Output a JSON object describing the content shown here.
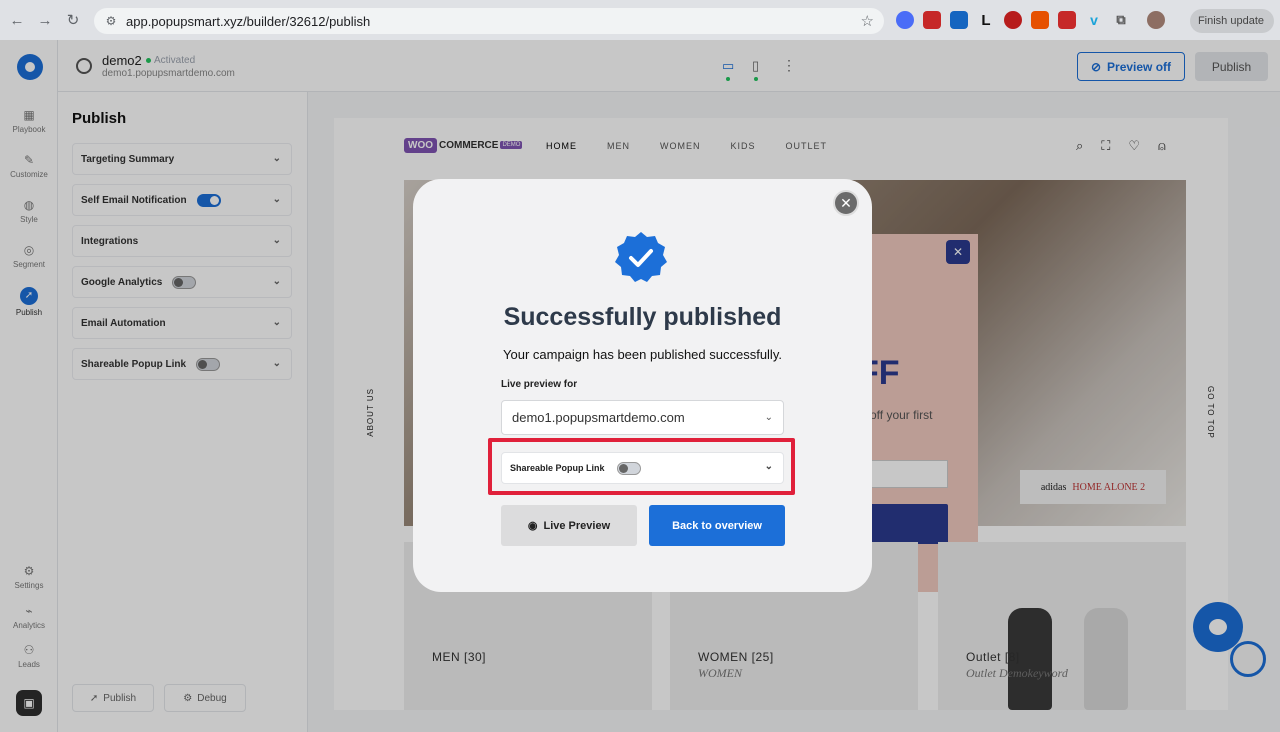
{
  "browser": {
    "url": "app.popupsmart.xyz/builder/32612/publish",
    "finish_update": "Finish update",
    "extensions": [
      "L"
    ]
  },
  "rail": {
    "items": [
      {
        "label": "Playbook",
        "icon": "playbook-icon"
      },
      {
        "label": "Customize",
        "icon": "pencil-icon"
      },
      {
        "label": "Style",
        "icon": "palette-icon"
      },
      {
        "label": "Segment",
        "icon": "target-icon"
      },
      {
        "label": "Publish",
        "icon": "rocket-icon"
      },
      {
        "label": "Settings",
        "icon": "gear-icon"
      },
      {
        "label": "Analytics",
        "icon": "chart-icon"
      },
      {
        "label": "Leads",
        "icon": "users-icon"
      }
    ]
  },
  "topbar": {
    "site_name": "demo2",
    "site_status": "Activated",
    "site_domain": "demo1.popupsmartdemo.com",
    "preview_off": "Preview off",
    "publish": "Publish"
  },
  "panel": {
    "title": "Publish",
    "sections": [
      {
        "label": "Targeting Summary",
        "toggle": null
      },
      {
        "label": "Self Email Notification",
        "toggle": true
      },
      {
        "label": "Integrations",
        "toggle": null
      },
      {
        "label": "Google Analytics",
        "toggle": false
      },
      {
        "label": "Email Automation",
        "toggle": null
      },
      {
        "label": "Shareable Popup Link",
        "toggle": false
      }
    ],
    "footer_publish": "Publish",
    "footer_debug": "Debug"
  },
  "store": {
    "logo_woo": "WOO",
    "logo_commerce": "COMMERCE",
    "logo_demo": "DEMO",
    "nav": [
      "HOME",
      "MEN",
      "WOMEN",
      "KIDS",
      "OUTLET"
    ],
    "side_left": "ABOUT US",
    "side_right": "GO TO TOP",
    "promo_big": "FF",
    "promo_sub": "off your first",
    "brand_badge": "adidas",
    "brand_badge2": "HOME ALONE 2",
    "categories": [
      {
        "label": "MEN [30]",
        "sub": ""
      },
      {
        "label": "WOMEN [25]",
        "sub": "WOMEN"
      },
      {
        "label": "Outlet [8]",
        "sub": "Outlet Demokeyword"
      }
    ]
  },
  "modal": {
    "title": "Successfully published",
    "subtitle": "Your campaign has been published successfully.",
    "live_label": "Live preview for",
    "domain": "demo1.popupsmartdemo.com",
    "share_label": "Shareable Popup Link",
    "share_toggle": false,
    "btn_live": "Live Preview",
    "btn_overview": "Back to overview"
  },
  "colors": {
    "accent": "#1c6fd8",
    "highlight": "#e0203a",
    "badge": "#1c6fd8"
  }
}
